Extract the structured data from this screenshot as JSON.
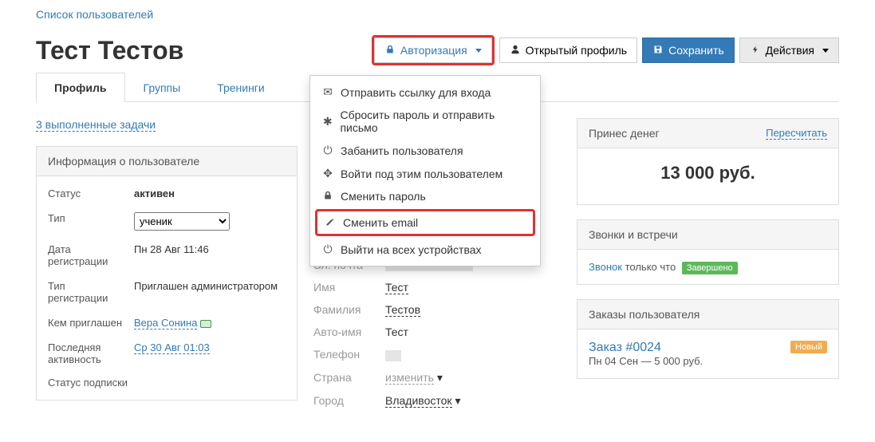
{
  "breadcrumb": {
    "users_list": "Список пользователей"
  },
  "header": {
    "title": "Тест Тестов",
    "auth_btn": "Авторизация",
    "open_profile_btn": "Открытый профиль",
    "save_btn": "Сохранить",
    "actions_btn": "Действия"
  },
  "tabs": {
    "profile": "Профиль",
    "groups": "Группы",
    "trainings": "Тренинги"
  },
  "tasks_link": "3 выполненные задачи",
  "auth_menu": {
    "send_login_link": "Отправить ссылку для входа",
    "reset_password_send": "Сбросить пароль и отправить письмо",
    "ban_user": "Забанить пользователя",
    "login_as_user": "Войти под этим пользователем",
    "change_password": "Сменить пароль",
    "change_email": "Сменить email",
    "logout_all": "Выйти на всех устройствах"
  },
  "info_panel": {
    "title": "Информация о пользователе",
    "status_label": "Статус",
    "status_value": "активен",
    "type_label": "Тип",
    "type_value": "ученик",
    "reg_date_label": "Дата регистрации",
    "reg_date_value": "Пн 28 Авг 11:46",
    "reg_type_label": "Тип регистрации",
    "reg_type_value": "Приглашен администратором",
    "invited_by_label": "Кем приглашен",
    "invited_by_value": "Вера Сонина",
    "last_activity_label": "Последняя активность",
    "last_activity_value": "Ср 30 Авг 01:03",
    "sub_status_label": "Статус подписки"
  },
  "contact": {
    "name_title": "Тест Тестов",
    "email_label": "Эл. почта",
    "fname_label": "Имя",
    "fname_value": "Тест",
    "lname_label": "Фамилия",
    "lname_value": "Тестов",
    "autoname_label": "Авто-имя",
    "autoname_value": "Тест",
    "phone_label": "Телефон",
    "country_label": "Страна",
    "country_value": "изменить",
    "city_label": "Город",
    "city_value": "Владивосток"
  },
  "money_panel": {
    "title": "Принес денег",
    "recalc": "Пересчитать",
    "amount": "13 000 руб."
  },
  "calls_panel": {
    "title": "Звонки и встречи",
    "call_link": "Звонок",
    "call_time": "только что",
    "call_badge": "Завершено"
  },
  "orders_panel": {
    "title": "Заказы пользователя",
    "order_link": "Заказ #0024",
    "order_sub": "Пн 04 Сен — 5 000 руб.",
    "order_badge": "Новый"
  }
}
